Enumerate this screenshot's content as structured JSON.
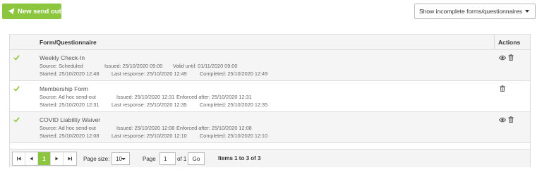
{
  "toolbar": {
    "new_send_out_label": "New send out",
    "filter_selected": "Show incomplete forms/questionnaires"
  },
  "table": {
    "columns": {
      "form": "Form/Questionnaire",
      "actions": "Actions"
    },
    "rows": [
      {
        "title": "Weekly Check-In",
        "source": "Source: Scheduled",
        "issued": "Issued: 25/10/2020 09:00",
        "extra": "Valid until: 01/11/2020 09:00",
        "started": "Started: 25/10/2020 12:48",
        "last_response": "Last response: 25/10/2020 12:49",
        "completed": "Completed: 25/10/2020 12:49",
        "actions": [
          "view",
          "delete"
        ]
      },
      {
        "title": "Membership Form",
        "source": "Source: Ad hoc send-out",
        "issued": "Issued: 25/10/2020 12:31",
        "extra": "Enforced after: 25/10/2020 12:31",
        "started": "Started: 25/10/2020 12:31",
        "last_response": "Last response: 25/10/2020 12:35",
        "completed": "Completed: 25/10/2020 12:35",
        "actions": [
          "delete"
        ]
      },
      {
        "title": "COVID Liability Waiver",
        "source": "Source: Ad hoc send-out",
        "issued": "Issued: 25/10/2020 12:08",
        "extra": "Enforced after: 25/10/2020 12:08",
        "started": "Started: 25/10/2020 12:08",
        "last_response": "Last response: 25/10/2020 12:10",
        "completed": "Completed: 25/10/2020 12:10",
        "actions": [
          "view",
          "delete"
        ]
      }
    ]
  },
  "pager": {
    "current_page": "1",
    "page_size_label": "Page size:",
    "page_size_value": "10",
    "page_label": "Page",
    "page_input_value": "1",
    "of_label": "of 1",
    "go_label": "Go",
    "items_label": "Items 1 to 3 of 3"
  },
  "colors": {
    "accent": "#8cc63f"
  },
  "icons": {
    "send": "paper-plane-icon",
    "complete": "check-icon",
    "view": "eye-icon",
    "delete": "trash-icon",
    "first": "first-page-icon",
    "prev": "prev-page-icon",
    "next": "next-page-icon",
    "last": "last-page-icon"
  }
}
